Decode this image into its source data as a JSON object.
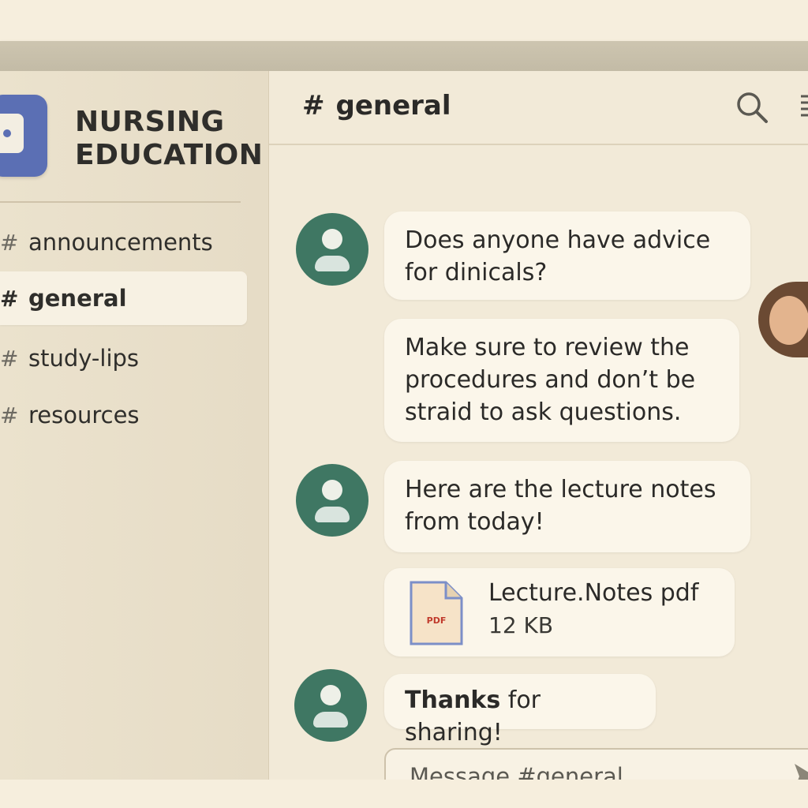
{
  "server": {
    "name_line1": "NURSING",
    "name_line2": "EDUCATION"
  },
  "channels": [
    {
      "hash": "#",
      "label": "announcements"
    },
    {
      "hash": "#",
      "label": "general"
    },
    {
      "hash": "#",
      "label": "study-lips"
    },
    {
      "hash": "#",
      "label": "resources"
    }
  ],
  "header": {
    "hash": "#",
    "title": "general"
  },
  "messages": [
    {
      "text": "Does anyone have advice for dinicals?"
    },
    {
      "text": "Make sure to review the procedures and don’t be straid to ask questions."
    },
    {
      "text": "Here are the lecture notes from today!"
    },
    {
      "bold": "Thanks",
      "rest": " for sharing!"
    }
  ],
  "attachment": {
    "name": "Lecture.Notes pdf",
    "size": "12 KB",
    "badge": "PDF"
  },
  "composer": {
    "placeholder": "Message #general"
  },
  "colors": {
    "accent_logo": "#5b6fb4",
    "avatar": "#3f7763",
    "background": "#efe6d2"
  }
}
